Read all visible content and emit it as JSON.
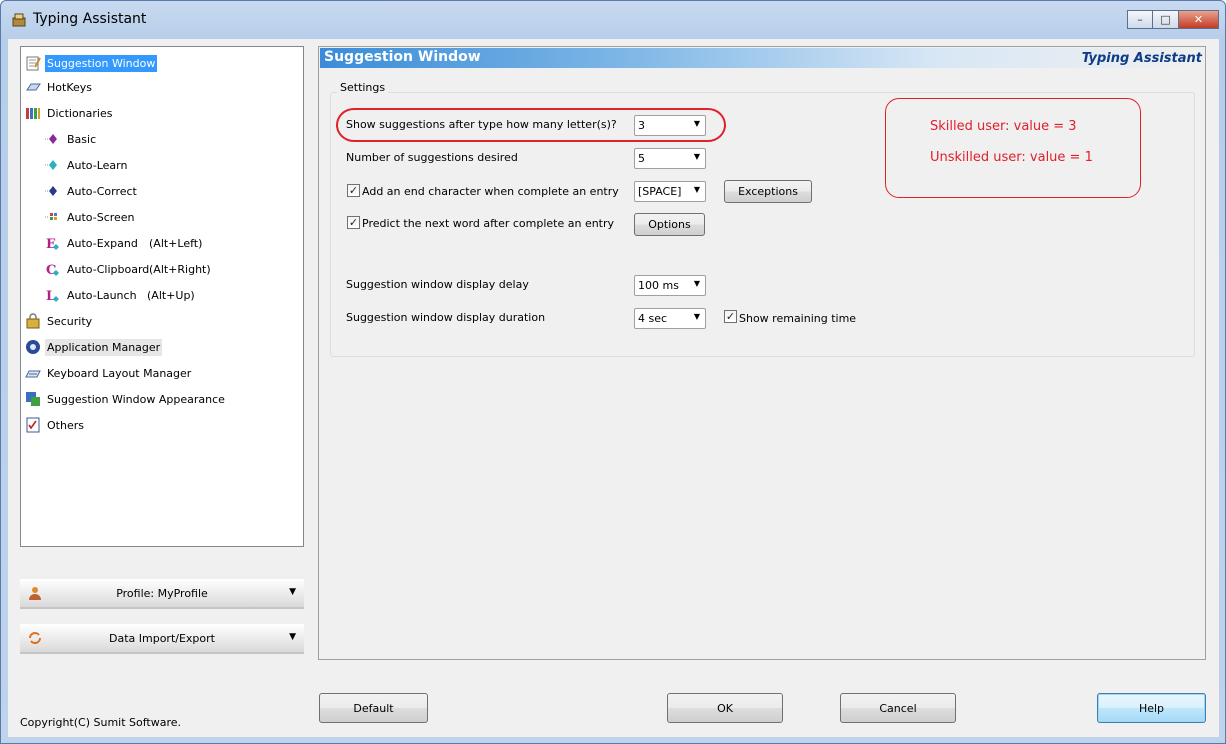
{
  "window": {
    "title": "Typing Assistant",
    "minimize_glyph": "–",
    "maximize_glyph": "□",
    "close_glyph": "✕"
  },
  "tree": {
    "items": [
      {
        "label": "Suggestion Window",
        "icon": "notepad-icon"
      },
      {
        "label": "HotKeys",
        "icon": "keyboard-key-icon"
      },
      {
        "label": "Dictionaries",
        "icon": "books-icon"
      },
      {
        "label": "Basic",
        "icon": "purple-diamond-icon"
      },
      {
        "label": "Auto-Learn",
        "icon": "cyan-diamond-icon"
      },
      {
        "label": "Auto-Correct",
        "icon": "blue-diamond-icon"
      },
      {
        "label": "Auto-Screen",
        "icon": "grid-icon"
      },
      {
        "label": "Auto-Expand",
        "icon": "letter-e-icon",
        "shortcut": "(Alt+Left)"
      },
      {
        "label": "Auto-Clipboard",
        "icon": "letter-c-icon",
        "shortcut": "(Alt+Right)"
      },
      {
        "label": "Auto-Launch",
        "icon": "letter-l-icon",
        "shortcut": "(Alt+Up)"
      },
      {
        "label": "Security",
        "icon": "lock-icon"
      },
      {
        "label": "Application Manager",
        "icon": "app-manager-icon"
      },
      {
        "label": "Keyboard Layout Manager",
        "icon": "keyboard-icon"
      },
      {
        "label": "Suggestion Window Appearance",
        "icon": "appearance-icon"
      },
      {
        "label": "Others",
        "icon": "checklist-icon"
      }
    ]
  },
  "side_panels": {
    "profile_label": "Profile: MyProfile",
    "import_label": "Data Import/Export",
    "dropdown_glyph": "▼"
  },
  "copyright": "Copyright(C) Sumit Software.",
  "main": {
    "header_title": "Suggestion Window",
    "brand": "Typing Assistant",
    "group_title": "Settings",
    "rows": {
      "letters_label": "Show suggestions after type how many letter(s)?",
      "letters_value": "3",
      "count_label": "Number of suggestions desired",
      "count_value": "5",
      "endchar_label": "Add an end character when complete an entry",
      "endchar_value": "[SPACE]",
      "endchar_checked": "✓",
      "exceptions_button": "Exceptions",
      "predict_label": "Predict the next word after complete an entry",
      "predict_checked": "✓",
      "options_button": "Options",
      "delay_label": "Suggestion window display delay",
      "delay_value": "100 ms",
      "duration_label": "Suggestion window display duration",
      "duration_value": "4 sec",
      "remaining_label": "Show remaining time",
      "remaining_checked": "✓"
    },
    "dropdown_glyph": "▼",
    "annotation": {
      "line1": "Skilled user: value = 3",
      "line2": "Unskilled user: value = 1"
    }
  },
  "buttons": {
    "default": "Default",
    "ok": "OK",
    "cancel": "Cancel",
    "help": "Help"
  },
  "colors": {
    "selection": "#3399ff",
    "header_blue": "#3a8cd8",
    "annotation_red": "#e0202a",
    "brand_text": "#0f3c86"
  }
}
